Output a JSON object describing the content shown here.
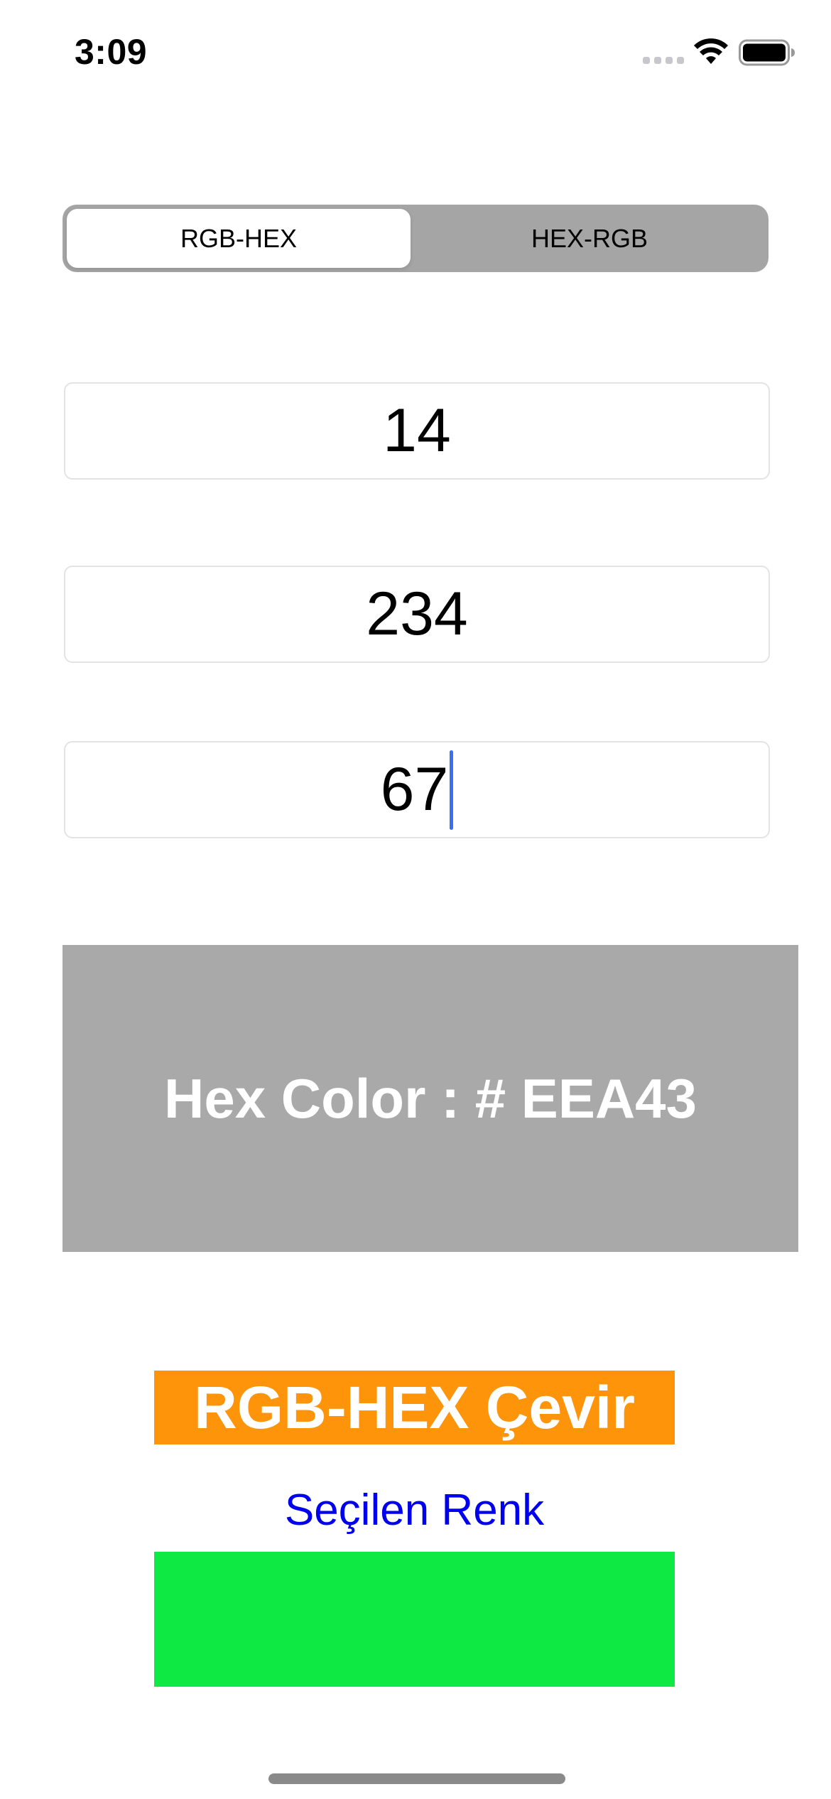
{
  "status_bar": {
    "time": "3:09",
    "icons": [
      "cell-signal-icon",
      "wifi-icon",
      "battery-icon"
    ]
  },
  "segmented_control": {
    "options": [
      "RGB-HEX",
      "HEX-RGB"
    ],
    "selected": "RGB-HEX"
  },
  "inputs": {
    "red": "14",
    "green": "234",
    "blue": "67"
  },
  "hex_result": {
    "text": "Hex Color : # EEA43",
    "background": "#a9a9a9"
  },
  "convert_button": {
    "label": "RGB-HEX Çevir",
    "color": "#fd9409"
  },
  "selected_color": {
    "label": "Seçilen Renk",
    "swatch": "#0eea43"
  }
}
